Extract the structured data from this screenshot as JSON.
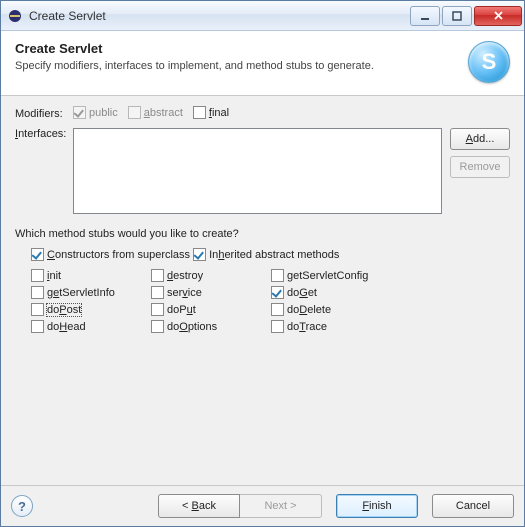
{
  "window": {
    "title": "Create Servlet"
  },
  "header": {
    "title": "Create Servlet",
    "desc": "Specify modifiers, interfaces to implement, and method stubs to generate.",
    "icon_letter": "S"
  },
  "modifiers": {
    "label": "Modifiers:",
    "public": {
      "text": "public",
      "checked": true,
      "enabled": false
    },
    "abstract": {
      "text": "abstract",
      "checked": false,
      "enabled": false
    },
    "final": {
      "text": "final",
      "checked": false,
      "enabled": true
    }
  },
  "interfaces": {
    "label": "Interfaces:",
    "add_btn": "Add...",
    "remove_btn": "Remove",
    "remove_enabled": false
  },
  "stubs": {
    "question": "Which method stubs would you like to create?",
    "constructors": {
      "text": "Constructors from superclass",
      "checked": true
    },
    "inherited": {
      "text": "Inherited abstract methods",
      "checked": true
    },
    "methods": [
      {
        "name": "init",
        "checked": false
      },
      {
        "name": "destroy",
        "checked": false
      },
      {
        "name": "getServletConfig",
        "checked": false
      },
      {
        "name": "getServletInfo",
        "checked": false
      },
      {
        "name": "service",
        "checked": false
      },
      {
        "name": "doGet",
        "checked": true
      },
      {
        "name": "doPost",
        "checked": false,
        "focused": true
      },
      {
        "name": "doPut",
        "checked": false
      },
      {
        "name": "doDelete",
        "checked": false
      },
      {
        "name": "doHead",
        "checked": false
      },
      {
        "name": "doOptions",
        "checked": false
      },
      {
        "name": "doTrace",
        "checked": false
      }
    ]
  },
  "footer": {
    "back": "< Back",
    "next": "Next >",
    "next_enabled": false,
    "finish": "Finish",
    "cancel": "Cancel"
  }
}
